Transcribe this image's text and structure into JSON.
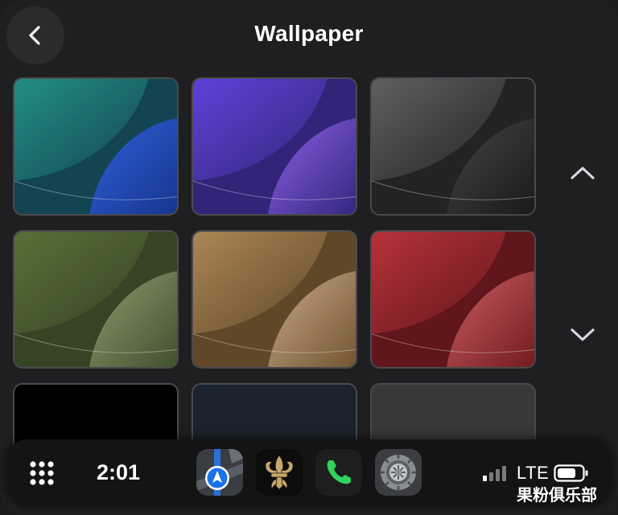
{
  "header": {
    "title": "Wallpaper",
    "back_icon": "chevron-left-icon"
  },
  "wallpapers": [
    {
      "name": "teal-blue",
      "bg": "#0a3d4a",
      "c1": "#1a8a80",
      "c2": "#2a5ad8",
      "c3": "#0c2f8c",
      "selected": false
    },
    {
      "name": "purple",
      "bg": "#2a1d74",
      "c1": "#5a3ad8",
      "c2": "#8a5ae8",
      "c3": "#2d1f7a",
      "selected": false
    },
    {
      "name": "graphite",
      "bg": "#1b1b1b",
      "c1": "#5a5a5a",
      "c2": "#3e3e3e",
      "c3": "#111111",
      "selected": false
    },
    {
      "name": "green",
      "bg": "#2e3d1e",
      "c1": "#53692f",
      "c2": "#8a9a6a",
      "c3": "#3a4a26",
      "selected": false
    },
    {
      "name": "gold",
      "bg": "#5a4020",
      "c1": "#a8824e",
      "c2": "#c8a888",
      "c3": "#6e4e28",
      "selected": false
    },
    {
      "name": "red",
      "bg": "#5a0d12",
      "c1": "#b52a32",
      "c2": "#c85a5e",
      "c3": "#6e1218",
      "selected": false
    },
    {
      "name": "black",
      "bg": "#000000",
      "selected": false
    },
    {
      "name": "navy",
      "bg": "#1b232e",
      "selected": false
    },
    {
      "name": "gray",
      "bg": "#3a3836",
      "selected": false
    }
  ],
  "scroll": {
    "up_icon": "chevron-up-icon",
    "down_icon": "chevron-down-icon"
  },
  "dock": {
    "apps_icon": "app-grid-icon",
    "time": "2:01",
    "apps": [
      {
        "name": "maps-app",
        "icon": "maps-icon"
      },
      {
        "name": "saints-app",
        "icon": "fleur-de-lis-icon"
      },
      {
        "name": "phone-app",
        "icon": "phone-icon"
      },
      {
        "name": "settings-app",
        "icon": "gear-icon"
      }
    ],
    "network": "LTE"
  },
  "watermark": "果粉俱乐部"
}
